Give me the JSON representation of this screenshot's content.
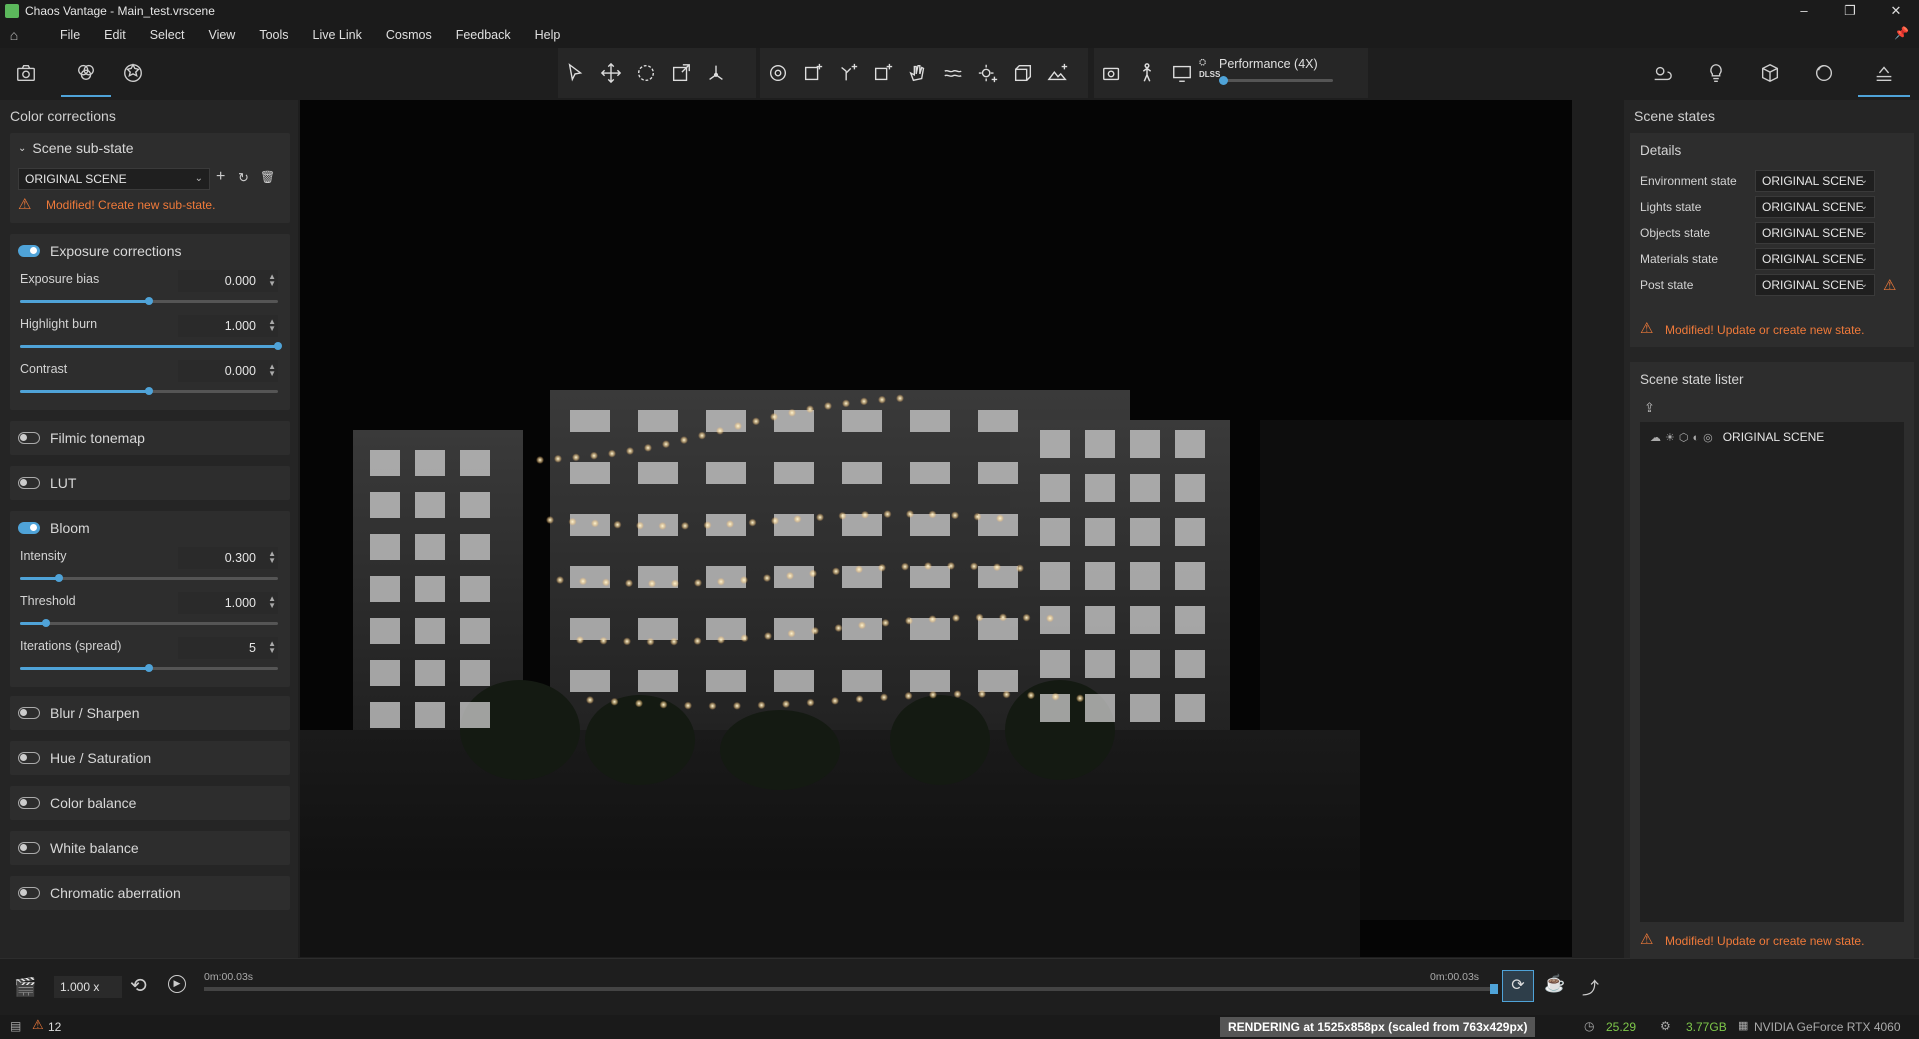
{
  "window": {
    "title": "Chaos Vantage - Main_test.vrscene",
    "minimize": "–",
    "restore": "❐",
    "close": "✕"
  },
  "menu": [
    "File",
    "Edit",
    "Select",
    "View",
    "Tools",
    "Live Link",
    "Cosmos",
    "Feedback",
    "Help"
  ],
  "toolbar": {
    "performance_label": "Performance (4X)",
    "dlss_label": "DLSS",
    "performance_level": 0.0
  },
  "left_panel": {
    "title": "Color corrections",
    "substate": {
      "header": "Scene sub-state",
      "dropdown_value": "ORIGINAL SCENE",
      "warning": "Modified! Create new sub-state."
    },
    "exposure": {
      "header": "Exposure corrections",
      "enabled": true,
      "params": [
        {
          "label": "Exposure bias",
          "value": "0.000",
          "level": 0.5
        },
        {
          "label": "Highlight burn",
          "value": "1.000",
          "level": 1.0
        },
        {
          "label": "Contrast",
          "value": "0.000",
          "level": 0.5
        }
      ]
    },
    "filmic": {
      "header": "Filmic tonemap",
      "enabled": false
    },
    "lut": {
      "header": "LUT",
      "enabled": false
    },
    "bloom": {
      "header": "Bloom",
      "enabled": true,
      "params": [
        {
          "label": "Intensity",
          "value": "0.300",
          "level": 0.15
        },
        {
          "label": "Threshold",
          "value": "1.000",
          "level": 0.1
        },
        {
          "label": "Iterations (spread)",
          "value": "5",
          "level": 0.5
        }
      ]
    },
    "collapsed": [
      {
        "header": "Blur / Sharpen",
        "enabled": false
      },
      {
        "header": "Hue / Saturation",
        "enabled": false
      },
      {
        "header": "Color balance",
        "enabled": false
      },
      {
        "header": "White balance",
        "enabled": false
      },
      {
        "header": "Chromatic aberration",
        "enabled": false
      }
    ]
  },
  "right_panel": {
    "title": "Scene states",
    "details_header": "Details",
    "states": [
      {
        "label": "Environment state",
        "value": "ORIGINAL SCENE"
      },
      {
        "label": "Lights state",
        "value": "ORIGINAL SCENE"
      },
      {
        "label": "Objects state",
        "value": "ORIGINAL SCENE"
      },
      {
        "label": "Materials state",
        "value": "ORIGINAL SCENE"
      },
      {
        "label": "Post state",
        "value": "ORIGINAL SCENE"
      }
    ],
    "details_warning": "Modified! Update or create new state.",
    "lister_header": "Scene state lister",
    "lister_item": "ORIGINAL SCENE",
    "lister_warning": "Modified! Update or create new state."
  },
  "timeline": {
    "speed": "1.000 x",
    "start_time": "0m:00.03s",
    "end_time": "0m:00.03s"
  },
  "status": {
    "warnings_count": "12",
    "rendering": "RENDERING at 1525x858px (scaled from 763x429px)",
    "fps": "25.29",
    "memory": "3.77GB",
    "gpu": "NVIDIA GeForce RTX 4060"
  },
  "colors": {
    "accent": "#4fa3d8",
    "warning": "#f07a3a",
    "fps": "#7ec84a"
  }
}
